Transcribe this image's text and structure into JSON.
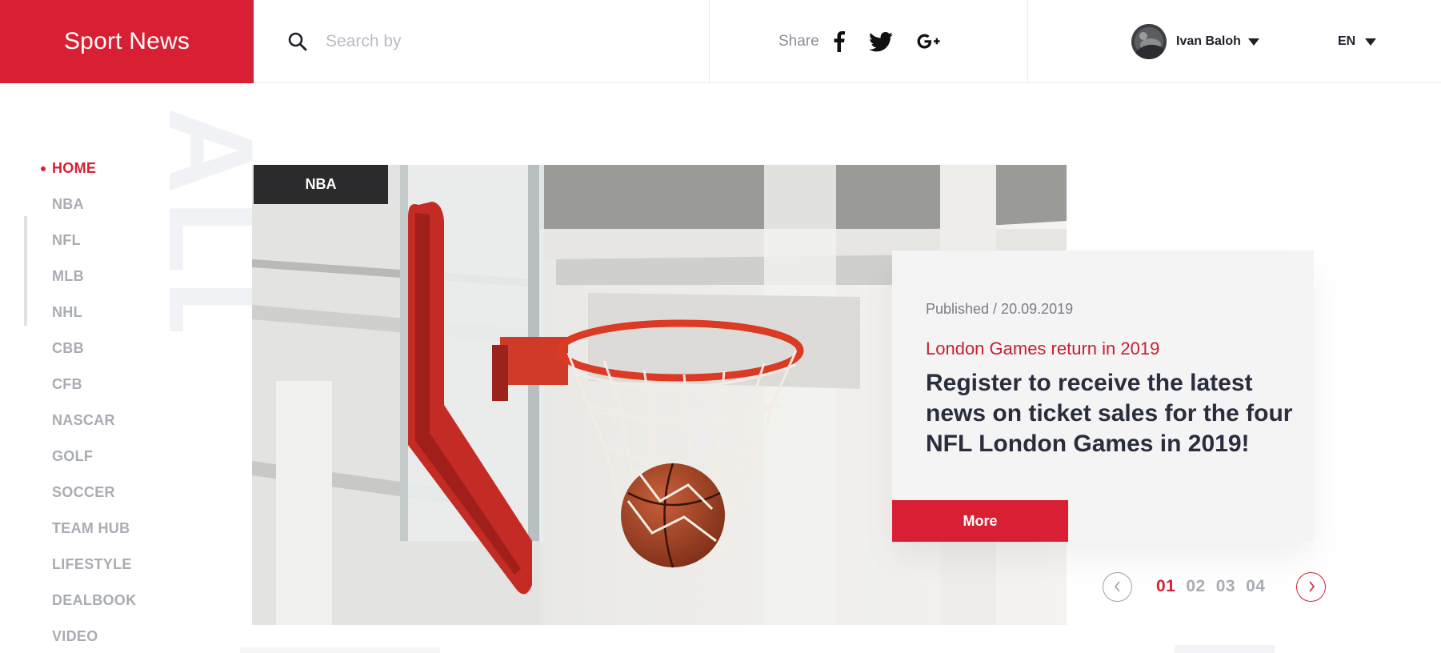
{
  "header": {
    "brand": "Sport News",
    "search": {
      "placeholder": "Search by",
      "icon": "search-icon"
    },
    "share": {
      "label": "Share",
      "networks": [
        {
          "name": "facebook",
          "icon": "facebook-icon"
        },
        {
          "name": "twitter",
          "icon": "twitter-icon"
        },
        {
          "name": "google-plus",
          "icon": "google-plus-icon"
        }
      ]
    },
    "user": {
      "name": "Ivan Baloh"
    },
    "language": {
      "selected": "EN"
    }
  },
  "sidebar": {
    "watermark": "ALL",
    "items": [
      {
        "label": "HOME",
        "active": true
      },
      {
        "label": "NBA"
      },
      {
        "label": "NFL"
      },
      {
        "label": "MLB"
      },
      {
        "label": "NHL"
      },
      {
        "label": "CBB"
      },
      {
        "label": "CFB"
      },
      {
        "label": "NASCAR"
      },
      {
        "label": "GOLF"
      },
      {
        "label": "SOCCER"
      },
      {
        "label": "TEAM HUB"
      },
      {
        "label": "LIFESTYLE"
      },
      {
        "label": "DEALBOOK"
      },
      {
        "label": "VIDEO"
      }
    ]
  },
  "hero": {
    "category": "NBA",
    "published": "Published / 20.09.2019",
    "kicker": "London Games return in 2019",
    "headline": "Register to receive the latest news on ticket sales for the four NFL London Games in 2019!",
    "more_label": "More"
  },
  "pager": {
    "pages": [
      "01",
      "02",
      "03",
      "04"
    ],
    "active": "01"
  },
  "colors": {
    "accent": "#d91f33",
    "nav_inactive": "#a9acb3",
    "headline": "#2a2d3e",
    "card_bg": "#f4f4f5"
  }
}
